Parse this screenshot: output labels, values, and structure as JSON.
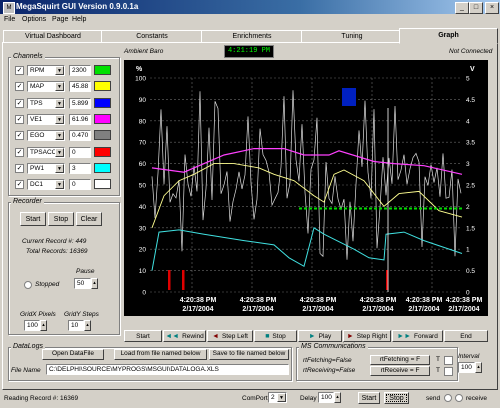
{
  "window": {
    "title": "MegaSquirt GUI Version 0.9.0.1a",
    "icon": "app-icon"
  },
  "menu": [
    {
      "label": "File"
    },
    {
      "label": "Options"
    },
    {
      "label": "Page"
    },
    {
      "label": "Help"
    }
  ],
  "tabs": [
    {
      "label": "Virtual Dashboard"
    },
    {
      "label": "Constants"
    },
    {
      "label": "Enrichments"
    },
    {
      "label": "Tuning"
    },
    {
      "label": "Graph"
    }
  ],
  "header": {
    "ambient": "Ambient Baro",
    "clock": "4:21:19 PM",
    "connection": "Not Connected"
  },
  "channels": {
    "title": "Channels",
    "items": [
      {
        "name": "RPM",
        "value": "2300",
        "color": "#00e000",
        "checked": true
      },
      {
        "name": "MAP",
        "value": "45.88",
        "color": "#ffff00",
        "checked": true
      },
      {
        "name": "TPS",
        "value": "5.899",
        "color": "#0000ff",
        "checked": true
      },
      {
        "name": "VE1",
        "value": "61.96",
        "color": "#ff00ff",
        "checked": true
      },
      {
        "name": "EGO",
        "value": "0.470",
        "color": "#808080",
        "checked": true
      },
      {
        "name": "TPSACC",
        "value": "0",
        "color": "#ff0000",
        "checked": true
      },
      {
        "name": "PW1",
        "value": "3",
        "color": "#00ffff",
        "checked": true
      },
      {
        "name": "DC1",
        "value": "0",
        "color": "#ffffff",
        "checked": true
      }
    ]
  },
  "recorder": {
    "title": "Recorder",
    "start": "Start",
    "stop": "Stop",
    "clear": "Clear",
    "current_label": "Current Record #: 449",
    "total_label": "Total Records: 16369",
    "stopped": "Stopped",
    "pause_label": "Pause",
    "pause_value": "50",
    "gridx_label": "GridX Pixels",
    "gridx_value": "100",
    "gridy_label": "GridY Steps",
    "gridy_value": "10"
  },
  "graph": {
    "left_unit": "%",
    "right_unit": "V",
    "left_ticks": [
      "100",
      "90",
      "80",
      "70",
      "60",
      "50",
      "40",
      "30",
      "20",
      "10",
      "0"
    ],
    "right_ticks": [
      "5",
      "4.5",
      "4",
      "3.5",
      "3",
      "2.5",
      "2",
      "1.5",
      "1",
      "0.5",
      "0"
    ],
    "time_labels": [
      {
        "time": "4:20:38 PM",
        "date": "2/17/2004"
      },
      {
        "time": "4:20:38 PM",
        "date": "2/17/2004"
      },
      {
        "time": "4:20:38 PM",
        "date": "2/17/2004"
      },
      {
        "time": "4:20:38 PM",
        "date": "2/17/2004"
      },
      {
        "time": "4:20:38 PM",
        "date": "2/17/2004"
      },
      {
        "time": "4:20:38 PM",
        "date": "2/17/2004"
      }
    ]
  },
  "nav": [
    {
      "label": "Start",
      "icon": ""
    },
    {
      "label": "Rewind",
      "icon": "rewind-icon"
    },
    {
      "label": "Step Left",
      "icon": "step-left-icon"
    },
    {
      "label": "Stop",
      "icon": "stop-icon"
    },
    {
      "label": "Play",
      "icon": "play-icon"
    },
    {
      "label": "Step Right",
      "icon": "step-right-icon"
    },
    {
      "label": "Forward",
      "icon": "forward-icon"
    },
    {
      "label": "End",
      "icon": ""
    }
  ],
  "datalogs": {
    "title": "DataLogs",
    "open": "Open DataFile",
    "load": "Load from file named below",
    "save": "Save to file named below",
    "file_label": "File Name",
    "file_value": "C:\\DELPHI\\SOURCE\\MYPROGS\\MSGUI\\DATALOGA.XLS"
  },
  "comms": {
    "title": "MS Communications",
    "rtfetching": "rtFetching=False",
    "rtreceiving": "rtReceiving=False",
    "btn_fetch": "rtFetching = F",
    "btn_receive": "rtReceive = F",
    "t": "T",
    "interval_label": "Interval",
    "interval_value": "100"
  },
  "status": {
    "reading": "Reading Record #: 16369",
    "comport_label": "ComPort",
    "comport_value": "2",
    "delay_label": "Delay",
    "delay_value": "100",
    "start": "Start",
    "stop": "Stop",
    "send": "send",
    "receive": "receive"
  }
}
